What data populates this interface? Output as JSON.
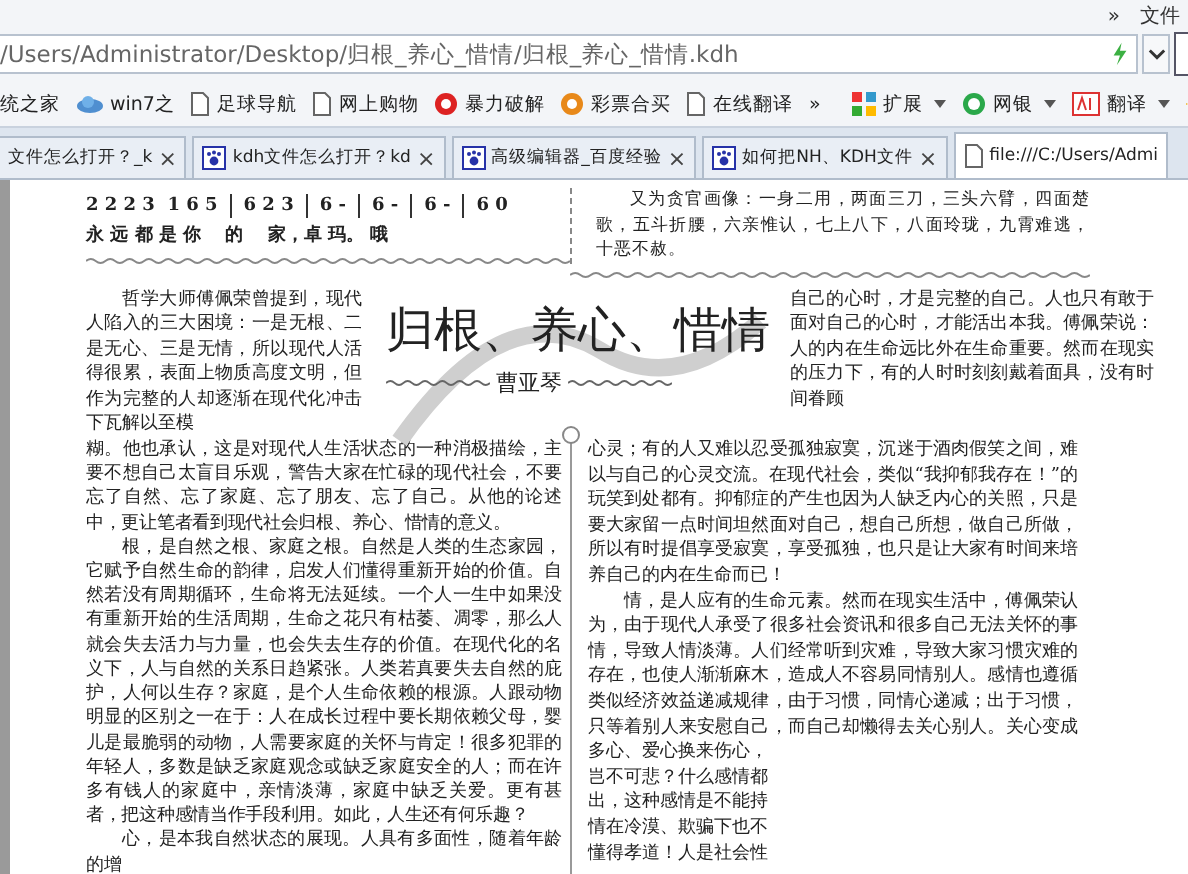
{
  "browser": {
    "menu_overflow": "»",
    "menu_label": "文件",
    "address": "/Users/Administrator/Desktop/归根_养心_惜情/归根_养心_惜情.kdh",
    "bookmarks": [
      {
        "label": "统之家",
        "kind": "none"
      },
      {
        "label": "win7之",
        "kind": "cloud"
      },
      {
        "label": "足球导航",
        "kind": "page"
      },
      {
        "label": "网上购物",
        "kind": "page"
      },
      {
        "label": "暴力破解",
        "kind": "red"
      },
      {
        "label": "彩票合买",
        "kind": "orange"
      },
      {
        "label": "在线翻译",
        "kind": "page"
      }
    ],
    "bookmarks_overflow": "»",
    "tools": [
      {
        "label": "扩展",
        "kind": "grid"
      },
      {
        "label": "网银",
        "kind": "shield"
      },
      {
        "label": "翻译",
        "kind": "translate"
      }
    ],
    "tabs": [
      {
        "title": "文件怎么打开？_k",
        "kind": "none",
        "close": "×",
        "selected": false
      },
      {
        "title": "kdh文件怎么打开？kd",
        "kind": "paw",
        "close": "×",
        "selected": false
      },
      {
        "title": "高级编辑器_百度经验",
        "kind": "paw",
        "close": "×",
        "selected": false
      },
      {
        "title": "如何把NH、KDH文件",
        "kind": "paw",
        "close": "×",
        "selected": false
      },
      {
        "title": "file:///C:/Users/Admi",
        "kind": "page",
        "selected": true
      }
    ]
  },
  "document": {
    "notation": {
      "measures": [
        "2 2 2 3  1 6 5",
        "6 2 3",
        "6 -",
        "6 -",
        "6 -",
        "6 0"
      ],
      "lyrics": "永 远 都 是 你　 的　 家，卓 玛。 哦"
    },
    "side_box": "又为贪官画像：一身二用，两面三刀，三头六臂，四面楚歌，五斗折腰，六亲惟认，七上八下，八面玲珑，九霄难逃，十恶不赦。",
    "title": "归根、养心、惜情",
    "author": "曹亚琴",
    "left_intro": "哲学大师傅佩荣曾提到，现代人陷入的三大困境：一是无根、二是无心、三是无情，所以现代人活得很累，表面上物质高度文明，但作为完整的人却逐渐在现代化冲击下瓦解以至模",
    "left_paragraphs": [
      "糊。他也承认，这是对现代人生活状态的一种消极描绘，主要不想自己太盲目乐观，警告大家在忙碌的现代社会，不要忘了自然、忘了家庭、忘了朋友、忘了自己。从他的论述中，更让笔者看到现代社会归根、养心、惜情的意义。",
      "根，是自然之根、家庭之根。自然是人类的生态家园，它赋予自然生命的韵律，启发人们懂得重新开始的价值。自然若没有周期循环，生命将无法延续。一个人一生中如果没有重新开始的生活周期，生命之花只有枯萎、凋零，那么人就会失去活力与力量，也会失去生存的价值。在现代化的名义下，人与自然的关系日趋紧张。人类若真要失去自然的庇护，人何以生存？家庭，是个人生命依赖的根源。人跟动物明显的区别之一在于：人在成长过程中要长期依赖父母，婴儿是最脆弱的动物，人需要家庭的关怀与肯定！很多犯罪的年轻人，多数是缺乏家庭观念或缺乏家庭安全的人；而在许多有钱人的家庭中，亲情淡薄，家庭中缺乏关爱。更有甚者，把这种感情当作手段利用。如此，人生还有何乐趣？",
      "心，是本我自然状态的展现。人具有多面性，随着年龄的增"
    ],
    "right_intro": "自己的心时，才是完整的自己。人也只有敢于面对自己的心时，才能活出本我。傅佩荣说：人的内在生命远比外在生命重要。然而在现实的压力下，有的人时时刻刻戴着面具，没有时间眷顾",
    "right_paragraphs": [
      "心灵；有的人又难以忍受孤独寂寞，沉迷于酒肉假笑之间，难以与自己的心灵交流。在现代社会，类似“我抑郁我存在！”的玩笑到处都有。抑郁症的产生也因为人缺乏内心的关照，只是要大家留一点时间坦然面对自己，想自己所想，做自己所做，所以有时提倡享受寂寞，享受孤独，也只是让大家有时间来培养自己的内在生命而已！",
      "情，是人应有的生命元素。然而在现实生活中，傅佩荣认为，由于现代人承受了很多社会资讯和很多自己无法关怀的事情，导致人情淡薄。人们经常听到灾难，导致大家习惯灾难的存在，也使人渐渐麻木，造成人不容易同情别人。感情也遵循类似经济效益递减规律，由于习惯，同情心递减；出于习惯，只等着别人来安慰自己，而自己却懒得去关心别人。关心变成多心、爱心换来伤心，"
    ],
    "right_cut_lines": [
      "岂不可悲？什么感情都",
      "出，这种感情是不能持",
      "情在冷漠、欺骗下也不",
      "懂得孝道！人是社会性"
    ]
  }
}
